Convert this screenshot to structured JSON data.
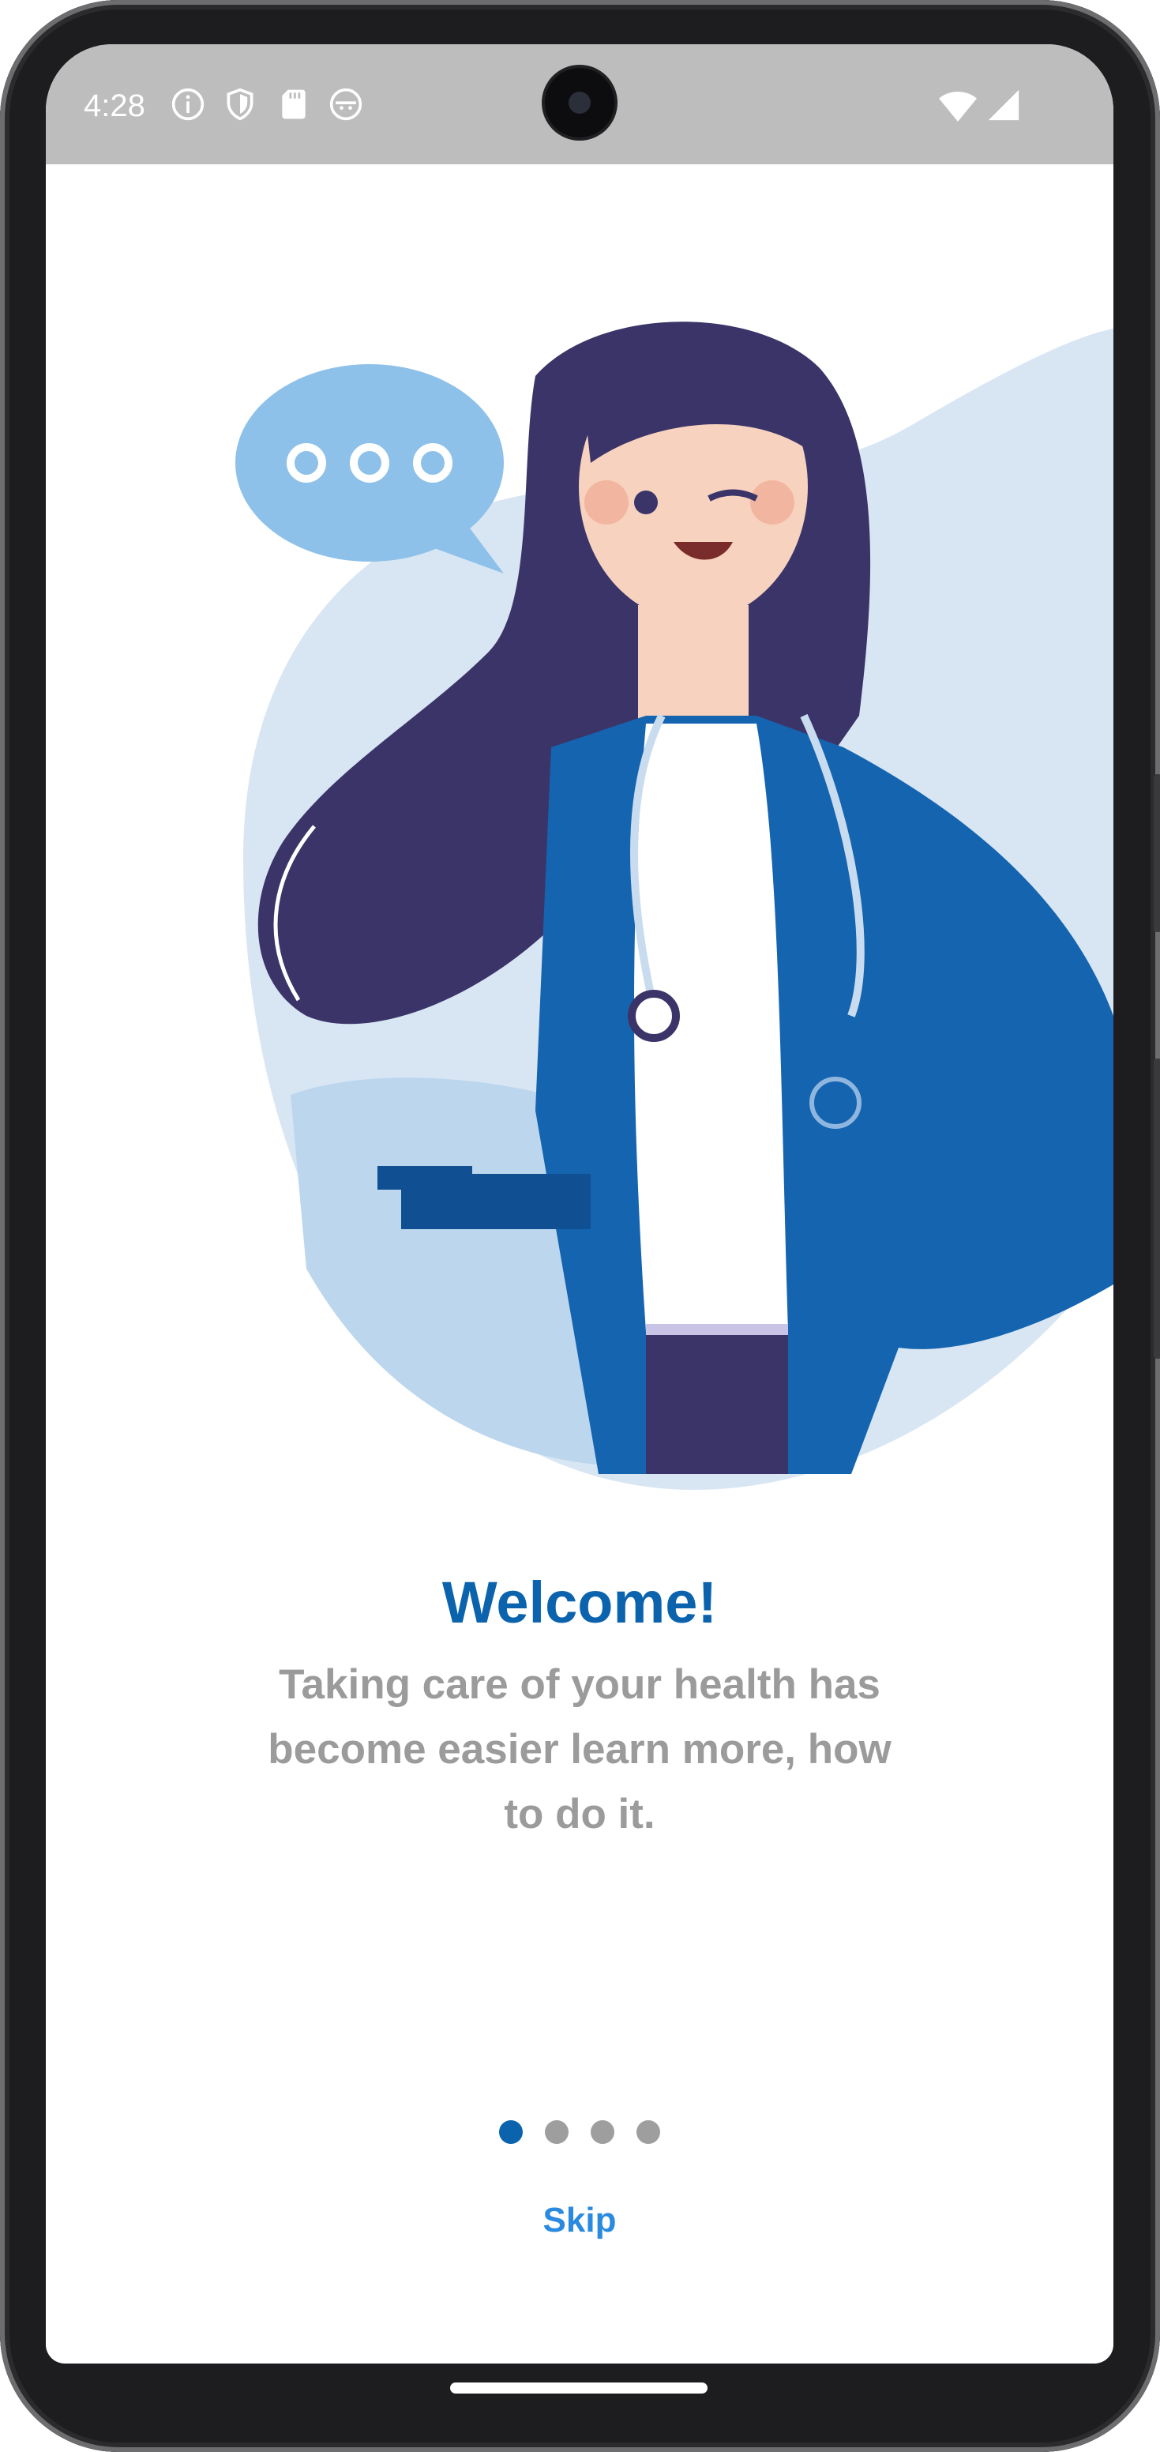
{
  "status_bar": {
    "time": "4:28",
    "icons": [
      "info-icon",
      "shield-icon",
      "sd-card-icon",
      "face-icon",
      "wifi-icon",
      "signal-icon"
    ]
  },
  "onboarding": {
    "title": "Welcome!",
    "subtitle": "Taking care of your health has become easier learn more, how to do it.",
    "skip_label": "Skip",
    "page_indicator": {
      "count": 4,
      "current": 1
    }
  },
  "colors": {
    "primary": "#0c63ad",
    "link": "#2a8ae0",
    "text_muted": "#9b9b9b",
    "dot_inactive": "#9e9e9e",
    "status_bar_bg": "#bdbdbd"
  }
}
